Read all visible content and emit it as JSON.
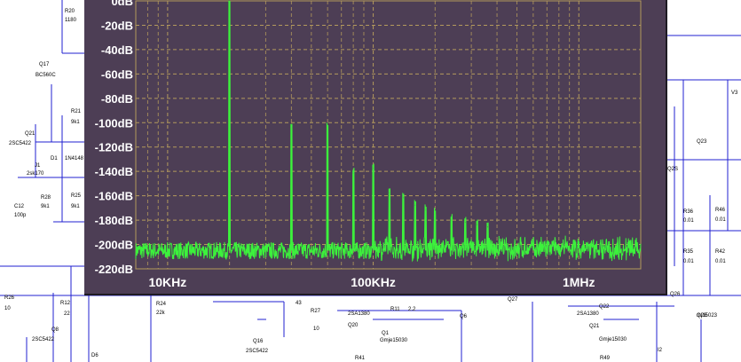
{
  "schematic": {
    "labels": [
      "R20",
      "1180",
      "Q17",
      "BC560C",
      "Gnd",
      "R21",
      "9k1",
      "Q21",
      "2SC5422",
      "D1",
      "1N4148",
      "J1",
      "2sk170",
      "C12",
      "100p",
      "R28",
      "9k1",
      "R25",
      "9k1",
      "R26",
      "10",
      "R12",
      "22",
      "Q8",
      "2SC5422",
      "D6",
      "R24",
      "22k",
      "Q16",
      "2SC5422",
      "43",
      "R27",
      "10",
      "Q20",
      "2SA1380",
      "R41",
      "Q1",
      "Gmje15030",
      "R11",
      "2.2",
      "Q6",
      "mj15023",
      "Q27",
      "Q22",
      "2SA1380",
      "Q21",
      "Gmje15030",
      "R49",
      "I2",
      "Q23",
      "mj15023",
      "Q2S",
      "mj15023",
      "R36",
      "0.01",
      "R46",
      "0.01",
      "R35",
      "0.01",
      "R42",
      "0.01",
      "Q26",
      "mj15023",
      "Q28",
      "mj15023",
      "V3"
    ]
  },
  "chart_data": {
    "type": "line",
    "title": "",
    "xlabel": "",
    "ylabel": "",
    "x_scale": "log",
    "xlim": [
      7000,
      2000000
    ],
    "ylim": [
      -220,
      0
    ],
    "x_tick_labels": [
      "10KHz",
      "100KHz",
      "1MHz"
    ],
    "x_tick_values": [
      10000,
      100000,
      1000000
    ],
    "y_tick_labels": [
      "0dB",
      "-20dB",
      "-40dB",
      "-60dB",
      "-80dB",
      "-100dB",
      "-120dB",
      "-140dB",
      "-160dB",
      "-180dB",
      "-200dB",
      "-220dB"
    ],
    "y_tick_values": [
      0,
      -20,
      -40,
      -60,
      -80,
      -100,
      -120,
      -140,
      -160,
      -180,
      -200,
      -220
    ],
    "grid": true,
    "noise_floor_db": -205,
    "peaks": [
      {
        "x": 20000,
        "y": -2
      },
      {
        "x": 40000,
        "y": -105
      },
      {
        "x": 60000,
        "y": -105
      },
      {
        "x": 80000,
        "y": -142
      },
      {
        "x": 100000,
        "y": -138
      },
      {
        "x": 120000,
        "y": -158
      },
      {
        "x": 140000,
        "y": -162
      },
      {
        "x": 160000,
        "y": -168
      },
      {
        "x": 180000,
        "y": -172
      },
      {
        "x": 200000,
        "y": -175
      },
      {
        "x": 240000,
        "y": -180
      },
      {
        "x": 280000,
        "y": -182
      },
      {
        "x": 320000,
        "y": -184
      },
      {
        "x": 360000,
        "y": -186
      }
    ],
    "colors": {
      "trace": "#3cf23c",
      "grid": "#b49a5c",
      "background": "#4d3e55",
      "labels": "#ffffff"
    }
  }
}
